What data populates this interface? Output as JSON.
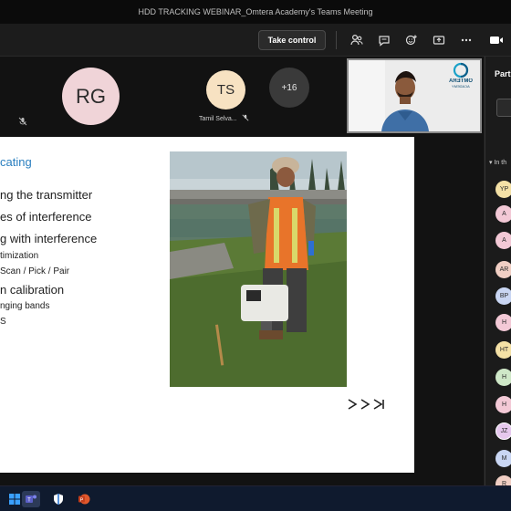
{
  "window": {
    "title": "HDD TRACKING WEBINAR_Omtera Academy's Teams Meeting"
  },
  "toolbar": {
    "take_control_label": "Take control",
    "icons": [
      "people-icon",
      "chat-icon",
      "reactions-icon",
      "share-tray-icon",
      "more-icon",
      "camera-icon"
    ]
  },
  "participants": {
    "rg": {
      "initials": "RG"
    },
    "ts": {
      "initials": "TS",
      "name": "Tamil Selva..."
    },
    "overflow": {
      "label": "+16"
    }
  },
  "video": {
    "logo_text": "OMTERA",
    "logo_sub": "ACADEMY"
  },
  "slide": {
    "title": "cating",
    "bullets": [
      "ng the transmitter",
      "es of interference",
      "g with interference",
      "timization",
      "Scan / Pick / Pair",
      "n calibration",
      "nging bands",
      "S"
    ]
  },
  "panel": {
    "title": "Part",
    "section_label": "In th",
    "avatars": [
      {
        "initials": "YP",
        "color": "#f4e1a6"
      },
      {
        "initials": "A",
        "color": "#f3c9d6"
      },
      {
        "initials": "A",
        "color": "#f3c9d6"
      },
      {
        "initials": "AR",
        "color": "#f1cfc4"
      },
      {
        "initials": "BP",
        "color": "#c9d6f3"
      },
      {
        "initials": "H",
        "color": "#f3c9d6"
      },
      {
        "initials": "HT",
        "color": "#f4e1a6"
      },
      {
        "initials": "H",
        "color": "#cfe8c8"
      },
      {
        "initials": "H",
        "color": "#f3c9d6"
      },
      {
        "initials": "JZ",
        "color": "#e6c8ee"
      },
      {
        "initials": "M",
        "color": "#c9d6f3"
      },
      {
        "initials": "R",
        "color": "#f1cfc4"
      }
    ]
  },
  "taskbar": {
    "apps": [
      "start-icon",
      "teams-icon",
      "defender-icon",
      "powerpoint-icon"
    ]
  }
}
